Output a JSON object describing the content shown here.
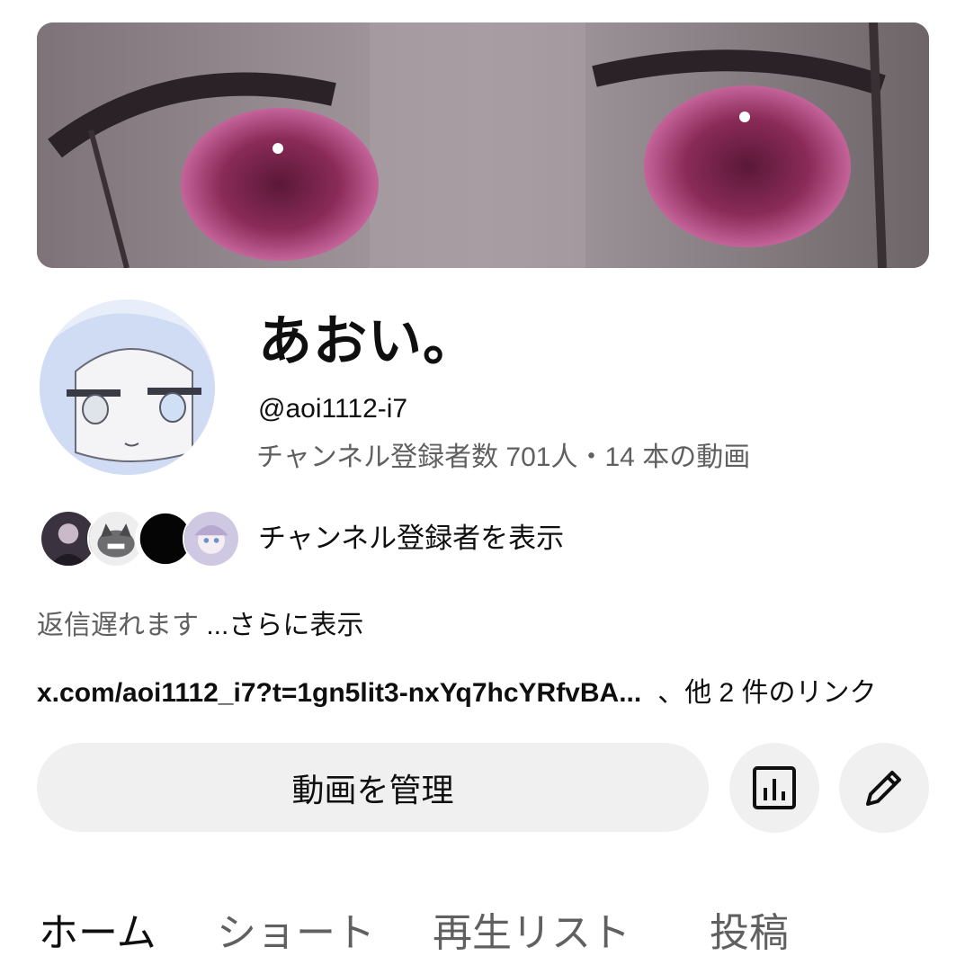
{
  "channel": {
    "name": "あおい。",
    "handle": "@aoi1112-i7",
    "stats": "チャンネル登録者数 701人・14 本の動画"
  },
  "subscribers": {
    "label": "チャンネル登録者を表示"
  },
  "description": {
    "text": "返信遅れます ",
    "more": "...さらに表示"
  },
  "links": {
    "text": "x.com/aoi1112_i7?t=1gn5lit3-nxYq7hcYRfvBA...",
    "others": "、他 2 件のリンク"
  },
  "actions": {
    "manage_label": "動画を管理",
    "analytics_icon": "analytics-bar-chart-icon",
    "edit_icon": "pencil-icon"
  },
  "tabs": [
    {
      "label": "ホーム",
      "active": true
    },
    {
      "label": "ショート",
      "active": false
    },
    {
      "label": "再生リスト",
      "active": false
    },
    {
      "label": "投稿",
      "active": false
    }
  ],
  "colors": {
    "primary_text": "#0f0f0f",
    "secondary_text": "#606060",
    "button_bg": "#f0f0f0"
  }
}
